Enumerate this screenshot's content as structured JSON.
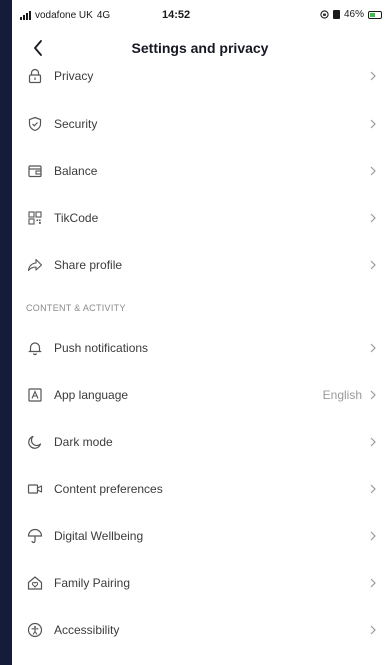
{
  "status_bar": {
    "carrier": "vodafone UK",
    "network": "4G",
    "time": "14:52",
    "battery": "46%"
  },
  "header": {
    "title": "Settings and privacy"
  },
  "account_items": [
    {
      "label": "Privacy",
      "icon": "lock-icon"
    },
    {
      "label": "Security",
      "icon": "shield-icon"
    },
    {
      "label": "Balance",
      "icon": "wallet-icon"
    },
    {
      "label": "TikCode",
      "icon": "qr-code-icon"
    },
    {
      "label": "Share profile",
      "icon": "share-icon"
    }
  ],
  "content_section": {
    "title": "CONTENT & ACTIVITY",
    "items": [
      {
        "label": "Push notifications",
        "icon": "bell-icon"
      },
      {
        "label": "App language",
        "value": "English",
        "icon": "language-icon"
      },
      {
        "label": "Dark mode",
        "icon": "moon-icon"
      },
      {
        "label": "Content preferences",
        "icon": "video-icon"
      },
      {
        "label": "Digital Wellbeing",
        "icon": "umbrella-icon"
      },
      {
        "label": "Family Pairing",
        "icon": "home-heart-icon"
      },
      {
        "label": "Accessibility",
        "icon": "accessibility-icon"
      }
    ]
  },
  "colors": {
    "frame_background": "#141c3a",
    "text": "#3b3b3b",
    "muted": "#9a9a9a",
    "battery_fill": "#3cbf4a"
  }
}
